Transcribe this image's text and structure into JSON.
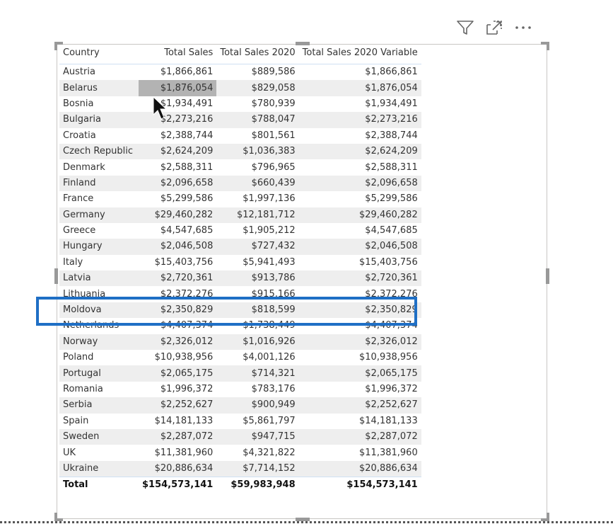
{
  "header_icons": [
    {
      "name": "filter-icon",
      "label": "Filter"
    },
    {
      "name": "focus-mode-icon",
      "label": "Focus mode"
    },
    {
      "name": "more-options-icon",
      "label": "More options"
    }
  ],
  "table": {
    "columns": [
      "Country",
      "Total Sales",
      "Total Sales 2020",
      "Total Sales 2020 Variable"
    ],
    "rows": [
      [
        "Austria",
        "$1,866,861",
        "$889,586",
        "$1,866,861"
      ],
      [
        "Belarus",
        "$1,876,054",
        "$829,058",
        "$1,876,054"
      ],
      [
        "Bosnia",
        "$1,934,491",
        "$780,939",
        "$1,934,491"
      ],
      [
        "Bulgaria",
        "$2,273,216",
        "$788,047",
        "$2,273,216"
      ],
      [
        "Croatia",
        "$2,388,744",
        "$801,561",
        "$2,388,744"
      ],
      [
        "Czech Republic",
        "$2,624,209",
        "$1,036,383",
        "$2,624,209"
      ],
      [
        "Denmark",
        "$2,588,311",
        "$796,965",
        "$2,588,311"
      ],
      [
        "Finland",
        "$2,096,658",
        "$660,439",
        "$2,096,658"
      ],
      [
        "France",
        "$5,299,586",
        "$1,997,136",
        "$5,299,586"
      ],
      [
        "Germany",
        "$29,460,282",
        "$12,181,712",
        "$29,460,282"
      ],
      [
        "Greece",
        "$4,547,685",
        "$1,905,212",
        "$4,547,685"
      ],
      [
        "Hungary",
        "$2,046,508",
        "$727,432",
        "$2,046,508"
      ],
      [
        "Italy",
        "$15,403,756",
        "$5,941,493",
        "$15,403,756"
      ],
      [
        "Latvia",
        "$2,720,361",
        "$913,786",
        "$2,720,361"
      ],
      [
        "Lithuania",
        "$2,372,276",
        "$915,166",
        "$2,372,276"
      ],
      [
        "Moldova",
        "$2,350,829",
        "$818,599",
        "$2,350,829"
      ],
      [
        "Netherlands",
        "$4,407,374",
        "$1,738,449",
        "$4,407,374"
      ],
      [
        "Norway",
        "$2,326,012",
        "$1,016,926",
        "$2,326,012"
      ],
      [
        "Poland",
        "$10,938,956",
        "$4,001,126",
        "$10,938,956"
      ],
      [
        "Portugal",
        "$2,065,175",
        "$714,321",
        "$2,065,175"
      ],
      [
        "Romania",
        "$1,996,372",
        "$783,176",
        "$1,996,372"
      ],
      [
        "Serbia",
        "$2,252,627",
        "$900,949",
        "$2,252,627"
      ],
      [
        "Spain",
        "$14,181,133",
        "$5,861,797",
        "$14,181,133"
      ],
      [
        "Sweden",
        "$2,287,072",
        "$947,715",
        "$2,287,072"
      ],
      [
        "UK",
        "$11,381,960",
        "$4,321,822",
        "$11,381,960"
      ],
      [
        "Ukraine",
        "$20,886,634",
        "$7,714,152",
        "$20,886,634"
      ]
    ],
    "total": [
      "Total",
      "$154,573,141",
      "$59,983,948",
      "$154,573,141"
    ],
    "selected_cell": {
      "row": "Belarus",
      "column": "Total Sales"
    },
    "highlighted_row": "Moldova"
  },
  "colors": {
    "highlight_box": "#1f6fc5",
    "selected_cell": "#b3b3b3",
    "alt_row": "#eeeeee"
  }
}
